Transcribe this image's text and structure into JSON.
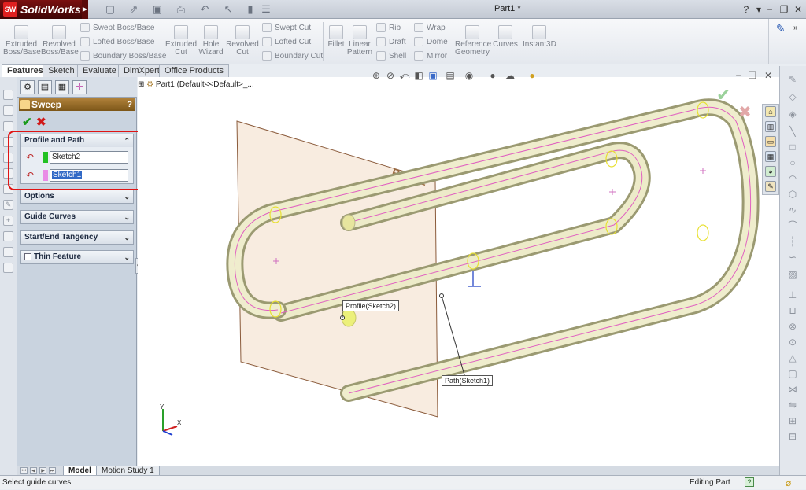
{
  "app": {
    "name": "SolidWorks",
    "logo_mark": "SW",
    "document_title": "Part1 *"
  },
  "title_bar": {
    "help": "?",
    "dropdown": "▾",
    "minimize": "−",
    "restore": "❐",
    "close": "✕"
  },
  "ribbon": {
    "extruded_boss": "Extruded Boss/Base",
    "revolved_boss": "Revolved Boss/Base",
    "swept_boss": "Swept Boss/Base",
    "lofted_boss": "Lofted Boss/Base",
    "boundary_boss": "Boundary Boss/Base",
    "extruded_cut": "Extruded Cut",
    "hole_wizard": "Hole Wizard",
    "revolved_cut": "Revolved Cut",
    "swept_cut": "Swept Cut",
    "lofted_cut": "Lofted Cut",
    "boundary_cut": "Boundary Cut",
    "fillet": "Fillet",
    "linear_pattern": "Linear Pattern",
    "rib": "Rib",
    "draft": "Draft",
    "shell": "Shell",
    "wrap": "Wrap",
    "dome": "Dome",
    "mirror": "Mirror",
    "reference_geometry": "Reference Geometry",
    "curves": "Curves",
    "instant3d": "Instant3D"
  },
  "command_tabs": [
    "Features",
    "Sketch",
    "Evaluate",
    "DimXpert",
    "Office Products"
  ],
  "property_manager": {
    "title": "Sweep",
    "help": "?",
    "ok": "✔",
    "cancel": "✖",
    "profile_and_path": {
      "title": "Profile and Path",
      "profile": "Sketch2",
      "path": "Sketch1",
      "profile_color": "#22c122",
      "path_color": "#e98be6"
    },
    "options": "Options",
    "guide_curves": "Guide Curves",
    "start_end_tangency": "Start/End Tangency",
    "thin_feature": "Thin Feature",
    "thin_feature_checked": false
  },
  "viewport": {
    "feature_tree_root": "Part1 (Default<<Default>_...",
    "plane_label": "Plane1",
    "profile_callout": "Profile(Sketch2)",
    "path_callout": "Path(Sketch1)",
    "triad": {
      "y": "Y",
      "x": "X"
    }
  },
  "bottom_tabs": [
    "Model",
    "Motion Study 1"
  ],
  "status_bar": {
    "message": "Select guide curves",
    "mode": "Editing Part",
    "help": "?"
  },
  "colors": {
    "accent": "#3169c6",
    "highlight_box": "#e01414",
    "header": "#9a6a22"
  }
}
